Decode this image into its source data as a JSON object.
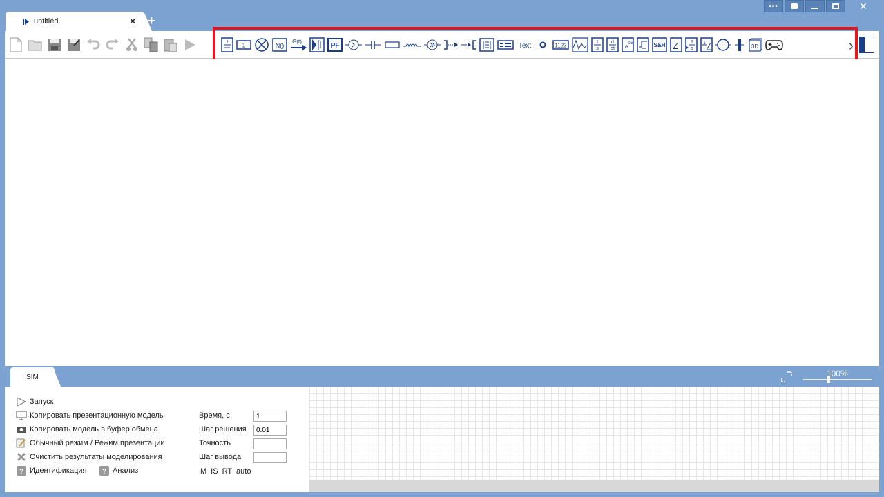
{
  "window": {
    "controls": [
      "more",
      "screenshot",
      "minimize",
      "maximize",
      "close"
    ]
  },
  "tabs": {
    "document": {
      "label": "untitled",
      "icon": "play-pause-icon"
    },
    "close_glyph": "×",
    "add_glyph": "+"
  },
  "toolbar": {
    "file_tools": [
      "new-file-icon",
      "open-folder-icon",
      "save-icon",
      "save-as-icon",
      "undo-icon",
      "redo-icon",
      "cut-icon",
      "copy-icon",
      "paste-icon",
      "run-icon"
    ],
    "blocks": [
      {
        "name": "transfer-function-block-icon",
        "label": ""
      },
      {
        "name": "constant-block-icon",
        "label": "1"
      },
      {
        "name": "multiplier-block-icon",
        "label": ""
      },
      {
        "name": "nonlinear-block-icon",
        "label": "N()"
      },
      {
        "name": "signal-source-block-icon",
        "label": "G(t)"
      },
      {
        "name": "mux-block-icon",
        "label": ""
      },
      {
        "name": "pf-block-icon",
        "label": "PF"
      },
      {
        "name": "summator-block-icon",
        "label": ""
      },
      {
        "name": "capacitor-block-icon",
        "label": ""
      },
      {
        "name": "resistor-block-icon",
        "label": ""
      },
      {
        "name": "inductor-block-icon",
        "label": ""
      },
      {
        "name": "amplifier-block-icon",
        "label": ""
      },
      {
        "name": "output-port-icon",
        "label": ""
      },
      {
        "name": "input-port-icon",
        "label": ""
      },
      {
        "name": "matrix-block-icon",
        "label": ""
      },
      {
        "name": "table-block-icon",
        "label": ""
      },
      {
        "name": "text-block-icon",
        "label": "Text"
      },
      {
        "name": "node-point-icon",
        "label": ""
      },
      {
        "name": "digital-display-icon",
        "label": "1123"
      },
      {
        "name": "scope-block-icon",
        "label": ""
      },
      {
        "name": "integrator-block-icon",
        "label": ""
      },
      {
        "name": "derivative-block-icon",
        "label": "d/dt"
      },
      {
        "name": "exponent-block-icon",
        "label": "Std"
      },
      {
        "name": "delay-block-icon",
        "label": ""
      },
      {
        "name": "sample-hold-block-icon",
        "label": "S&H"
      },
      {
        "name": "z-transform-block-icon",
        "label": "Z"
      },
      {
        "name": "discrete-integrator-icon",
        "label": ""
      },
      {
        "name": "saturation-block-icon",
        "label": ""
      },
      {
        "name": "loop-block-icon",
        "label": ""
      },
      {
        "name": "bus-block-icon",
        "label": ""
      },
      {
        "name": "3d-block-icon",
        "label": "3D"
      },
      {
        "name": "gamepad-block-icon",
        "label": ""
      }
    ],
    "more_glyph": "›"
  },
  "bottom": {
    "sim_tab_label": "SIM",
    "zoom_label": "100%",
    "zoom_value_percent": 100
  },
  "sim_panel": {
    "commands": [
      {
        "icon": "run-icon",
        "label": "Запуск"
      },
      {
        "icon": "presentation-icon",
        "label": "Копировать презентационную модель"
      },
      {
        "icon": "camera-icon",
        "label": "Копировать модель в буфер обмена"
      },
      {
        "icon": "mode-switch-icon",
        "label": "Обычный режим / Режим презентации"
      },
      {
        "icon": "clear-icon",
        "label": "Очистить результаты моделирования"
      }
    ],
    "help_items": [
      {
        "icon": "help-icon",
        "label": "Идентификация"
      },
      {
        "icon": "help-icon",
        "label": "Анализ"
      }
    ],
    "params": [
      {
        "label": "Время, с",
        "value": "1"
      },
      {
        "label": "Шаг решения",
        "value": "0.01"
      },
      {
        "label": "Точность",
        "value": ""
      },
      {
        "label": "Шаг вывода",
        "value": ""
      }
    ],
    "modes": [
      "M",
      "IS",
      "RT",
      "auto"
    ]
  },
  "colors": {
    "chrome": "#7ba2d0",
    "icon_blue": "#1a3e8c",
    "highlight_red": "#e8141b"
  }
}
